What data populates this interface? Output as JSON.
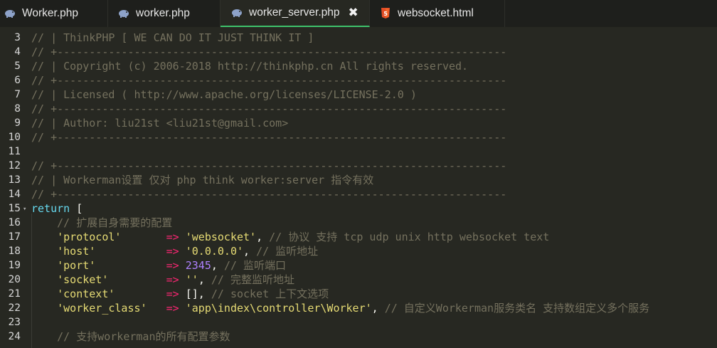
{
  "tabs": [
    {
      "label": "Worker.php",
      "icon": "php-elephant-icon"
    },
    {
      "label": "worker.php",
      "icon": "php-elephant-icon"
    },
    {
      "label": "worker_server.php",
      "icon": "php-elephant-icon",
      "active": true,
      "close": "✖"
    },
    {
      "label": "websocket.html",
      "icon": "html5-icon"
    }
  ],
  "colors": {
    "comment": "#75715e",
    "keyword": "#66d9ef",
    "string": "#e6db74",
    "operator": "#f92672",
    "number": "#ae81ff",
    "active_tab_underline": "#3fc26b"
  },
  "lines": [
    {
      "n": "3",
      "parts": [
        [
          "cm",
          "// | ThinkPHP [ WE CAN DO IT JUST THINK IT ]"
        ]
      ]
    },
    {
      "n": "4",
      "parts": [
        [
          "cm",
          "// +----------------------------------------------------------------------"
        ]
      ]
    },
    {
      "n": "5",
      "parts": [
        [
          "cm",
          "// | Copyright (c) 2006-2018 http://thinkphp.cn All rights reserved."
        ]
      ]
    },
    {
      "n": "6",
      "parts": [
        [
          "cm",
          "// +----------------------------------------------------------------------"
        ]
      ]
    },
    {
      "n": "7",
      "parts": [
        [
          "cm",
          "// | Licensed ( http://www.apache.org/licenses/LICENSE-2.0 )"
        ]
      ]
    },
    {
      "n": "8",
      "parts": [
        [
          "cm",
          "// +----------------------------------------------------------------------"
        ]
      ]
    },
    {
      "n": "9",
      "parts": [
        [
          "cm",
          "// | Author: liu21st <liu21st@gmail.com>"
        ]
      ]
    },
    {
      "n": "10",
      "parts": [
        [
          "cm",
          "// +----------------------------------------------------------------------"
        ]
      ]
    },
    {
      "n": "11",
      "parts": []
    },
    {
      "n": "12",
      "parts": [
        [
          "cm",
          "// +----------------------------------------------------------------------"
        ]
      ]
    },
    {
      "n": "13",
      "parts": [
        [
          "cm",
          "// | Workerman设置 仅对 php think worker:server 指令有效"
        ]
      ]
    },
    {
      "n": "14",
      "parts": [
        [
          "cm",
          "// +----------------------------------------------------------------------"
        ]
      ]
    },
    {
      "n": "15",
      "parts": [
        [
          "kw",
          "return"
        ],
        [
          "pl",
          " ["
        ]
      ]
    },
    {
      "n": "16",
      "parts": [
        [
          "pl",
          "    "
        ],
        [
          "cm",
          "// 扩展自身需要的配置"
        ]
      ]
    },
    {
      "n": "17",
      "parts": [
        [
          "pl",
          "    "
        ],
        [
          "key",
          "'protocol'"
        ],
        [
          "pl",
          "       "
        ],
        [
          "op",
          "=>"
        ],
        [
          "pl",
          " "
        ],
        [
          "str",
          "'websocket'"
        ],
        [
          "pl",
          ", "
        ],
        [
          "cm",
          "// 协议 支持 tcp udp unix http websocket text"
        ]
      ]
    },
    {
      "n": "18",
      "parts": [
        [
          "pl",
          "    "
        ],
        [
          "key",
          "'host'"
        ],
        [
          "pl",
          "           "
        ],
        [
          "op",
          "=>"
        ],
        [
          "pl",
          " "
        ],
        [
          "str",
          "'0.0.0.0'"
        ],
        [
          "pl",
          ", "
        ],
        [
          "cm",
          "// 监听地址"
        ]
      ]
    },
    {
      "n": "19",
      "parts": [
        [
          "pl",
          "    "
        ],
        [
          "key",
          "'port'"
        ],
        [
          "pl",
          "           "
        ],
        [
          "op",
          "=>"
        ],
        [
          "pl",
          " "
        ],
        [
          "num",
          "2345"
        ],
        [
          "pl",
          ", "
        ],
        [
          "cm",
          "// 监听端口"
        ]
      ]
    },
    {
      "n": "20",
      "parts": [
        [
          "pl",
          "    "
        ],
        [
          "key",
          "'socket'"
        ],
        [
          "pl",
          "         "
        ],
        [
          "op",
          "=>"
        ],
        [
          "pl",
          " "
        ],
        [
          "str",
          "''"
        ],
        [
          "pl",
          ", "
        ],
        [
          "cm",
          "// 完整监听地址"
        ]
      ]
    },
    {
      "n": "21",
      "parts": [
        [
          "pl",
          "    "
        ],
        [
          "key",
          "'context'"
        ],
        [
          "pl",
          "        "
        ],
        [
          "op",
          "=>"
        ],
        [
          "pl",
          " [], "
        ],
        [
          "cm",
          "// socket 上下文选项"
        ]
      ]
    },
    {
      "n": "22",
      "parts": [
        [
          "pl",
          "    "
        ],
        [
          "key",
          "'worker_class'"
        ],
        [
          "pl",
          "   "
        ],
        [
          "op",
          "=>"
        ],
        [
          "pl",
          " "
        ],
        [
          "str",
          "'app\\index\\controller\\Worker'"
        ],
        [
          "pl",
          ", "
        ],
        [
          "cm",
          "// 自定义Workerman服务类名 支持数组定义多个服务"
        ]
      ]
    },
    {
      "n": "23",
      "parts": []
    },
    {
      "n": "24",
      "parts": [
        [
          "pl",
          "    "
        ],
        [
          "cm",
          "// 支持workerman的所有配置参数"
        ]
      ]
    }
  ]
}
